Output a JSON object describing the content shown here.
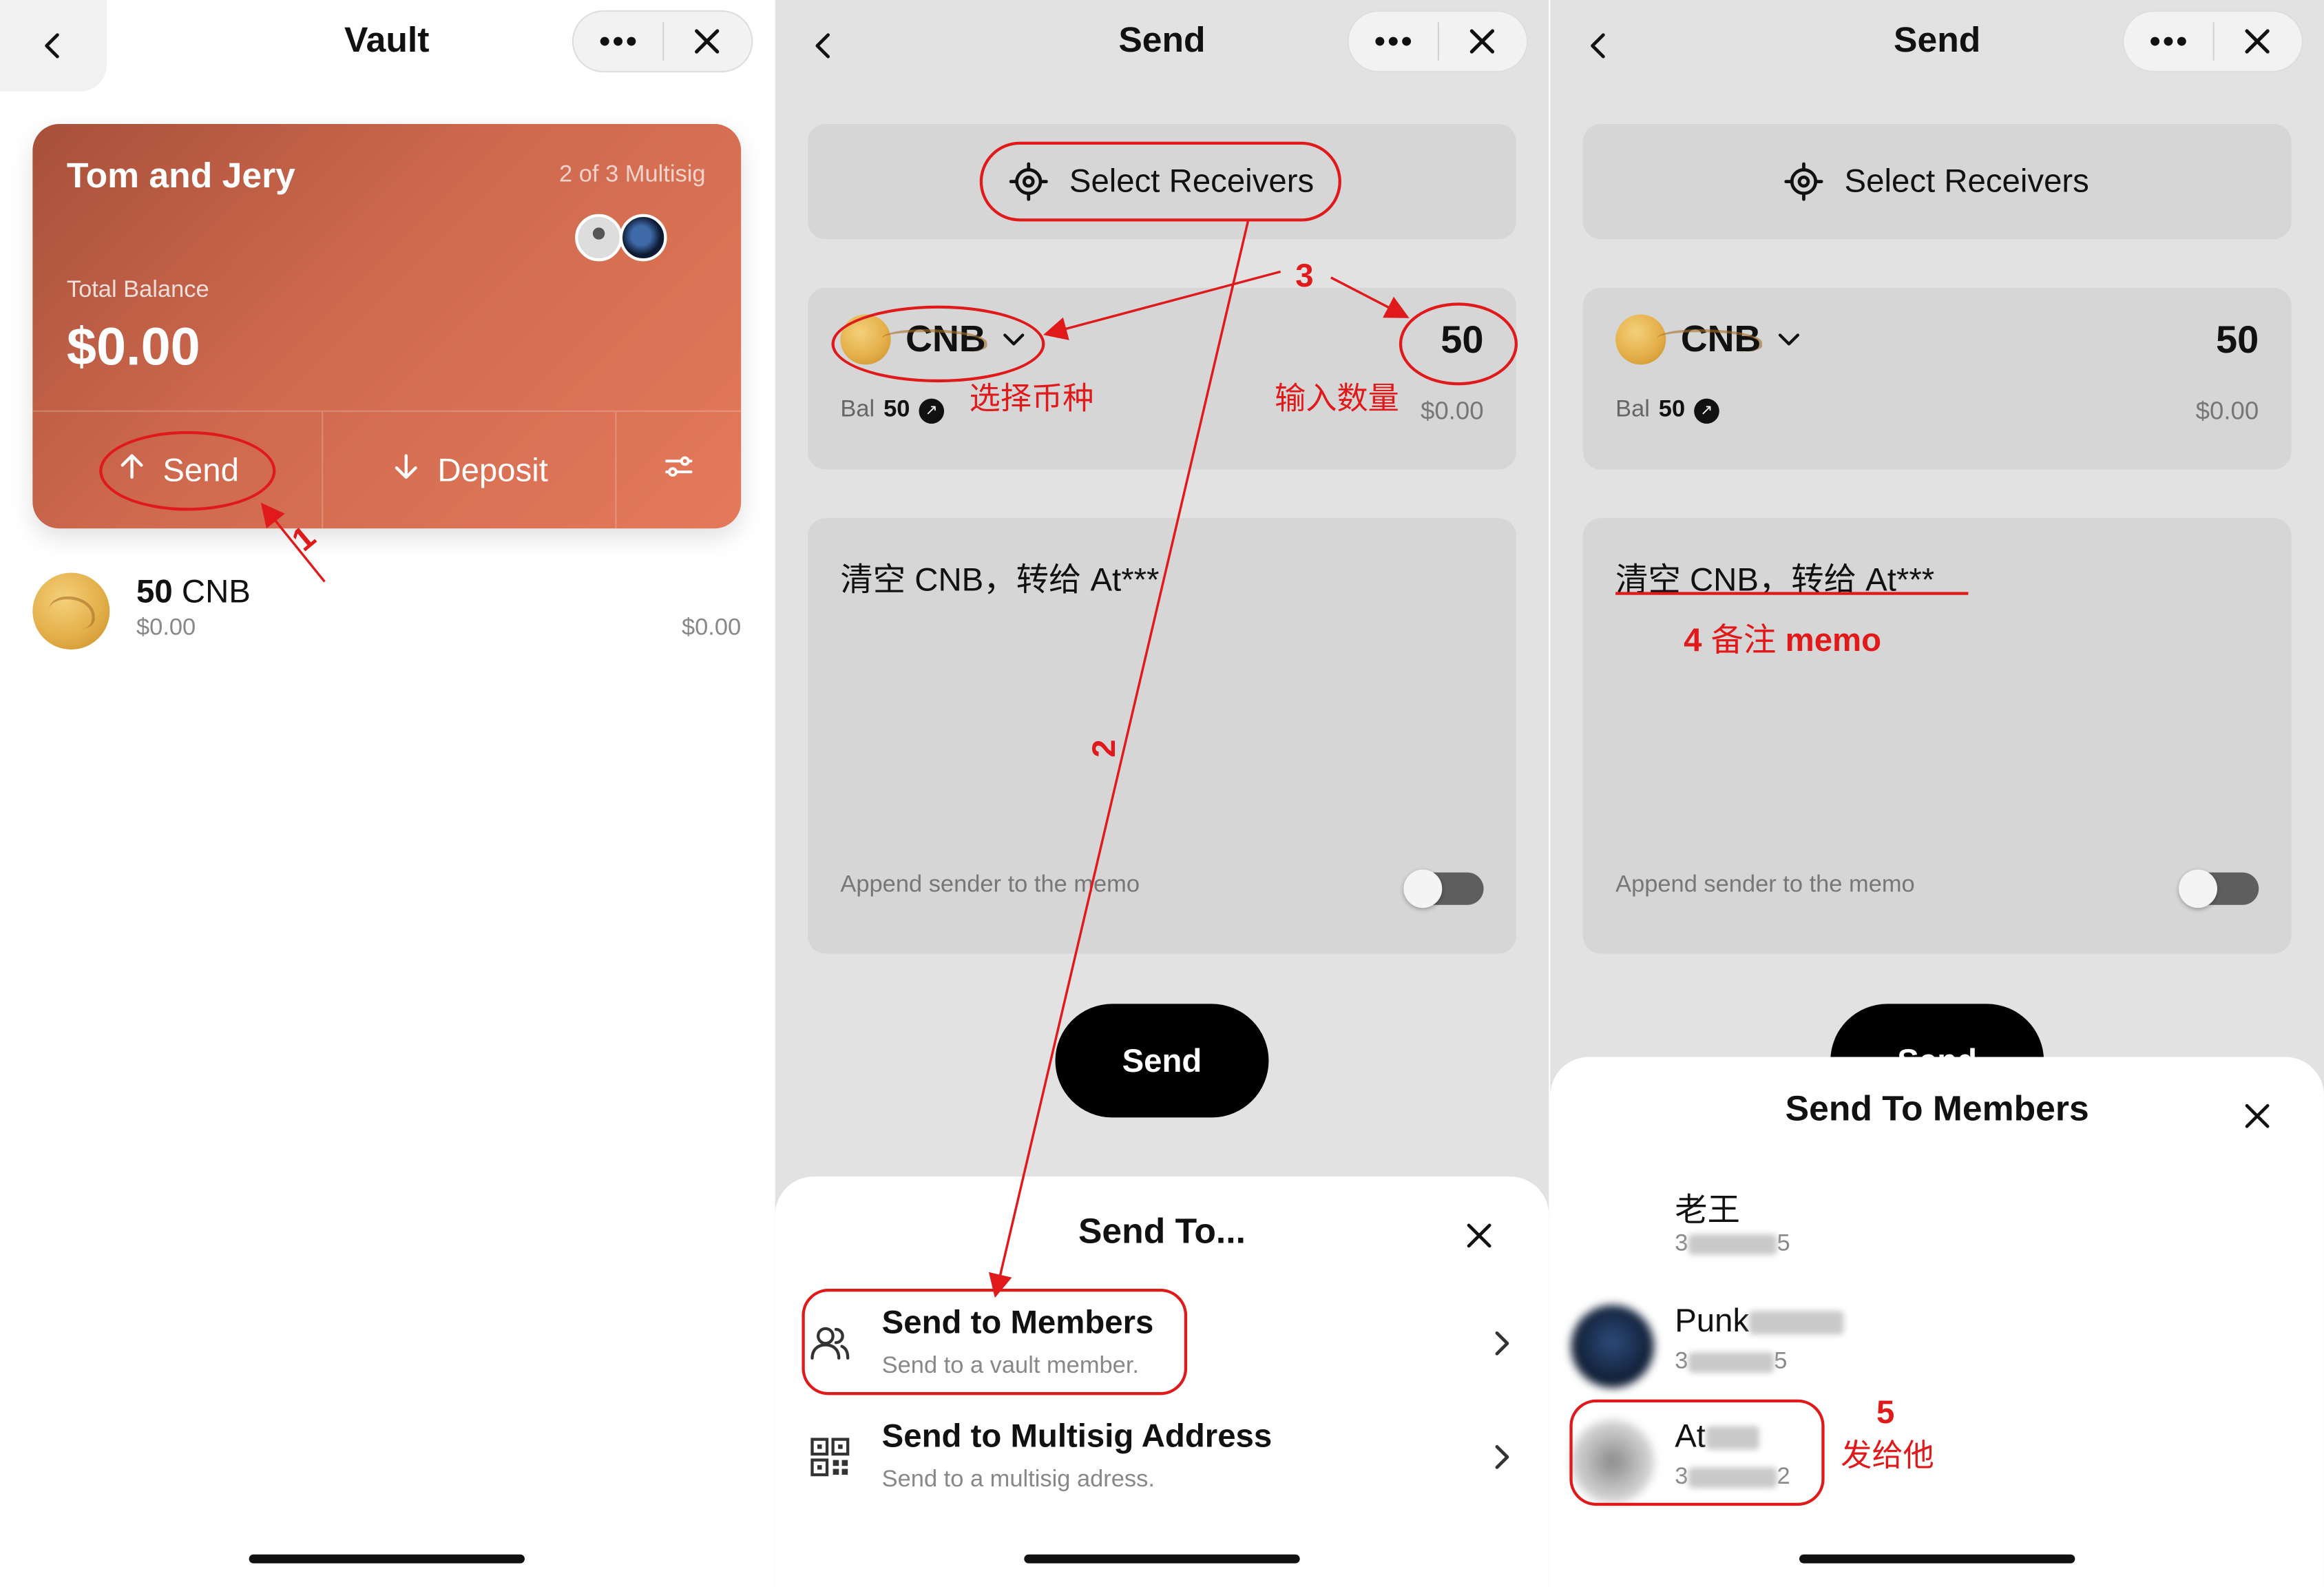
{
  "panel1": {
    "title": "Vault",
    "vault_name": "Tom and Jery",
    "multisig_label": "2 of 3 Multisig",
    "total_balance_label": "Total Balance",
    "total_balance": "$0.00",
    "actions": {
      "send": "Send",
      "deposit": "Deposit"
    },
    "asset": {
      "amount": "50",
      "symbol": "CNB",
      "usd_left": "$0.00",
      "usd_right": "$0.00"
    }
  },
  "panel2": {
    "title": "Send",
    "select_receivers": "Select Receivers",
    "token": "CNB",
    "amount": "50",
    "bal_label": "Bal",
    "bal_value": "50",
    "usd_value": "$0.00",
    "memo": "清空 CNB，转给 At***",
    "append_sender": "Append sender to the memo",
    "send_button": "Send",
    "sheet": {
      "title": "Send To...",
      "options": [
        {
          "title": "Send to Members",
          "subtitle": "Send to a vault member."
        },
        {
          "title": "Send to Multisig Address",
          "subtitle": "Send to a multisig adress."
        }
      ]
    }
  },
  "panel3": {
    "title": "Send",
    "select_receivers": "Select Receivers",
    "token": "CNB",
    "amount": "50",
    "bal_label": "Bal",
    "bal_value": "50",
    "usd_value": "$0.00",
    "memo": "清空 CNB，转给 At***",
    "append_sender": "Append sender to the memo",
    "send_button_partial": "Send",
    "sheet": {
      "title": "Send To Members",
      "members": [
        {
          "name": "老王",
          "addr_start": "3",
          "addr_end": "5"
        },
        {
          "name": "Punk",
          "addr_start": "3",
          "addr_end": "5"
        },
        {
          "name": "At",
          "addr_start": "3",
          "addr_end": "2"
        }
      ]
    }
  },
  "annotations": {
    "step1": "1",
    "step2": "2",
    "step3": "3",
    "select_token": "选择币种",
    "enter_amount": "输入数量",
    "step4_num": "4",
    "step4_text": "备注",
    "step4_memo": "memo",
    "step5_num": "5",
    "step5_text": "发给他"
  },
  "colors": {
    "annotation_red": "#e0191b",
    "card_gradient_start": "#a8503a",
    "card_gradient_end": "#e5795a",
    "send_button_bg": "#000000"
  },
  "icons": [
    "chevron-left-icon",
    "more-dots-icon",
    "close-icon",
    "arrow-up-icon",
    "arrow-down-icon",
    "filter-icon",
    "target-icon",
    "chevron-down-icon",
    "arrow-out-icon",
    "members-icon",
    "qr-code-icon",
    "chevron-right-icon"
  ]
}
